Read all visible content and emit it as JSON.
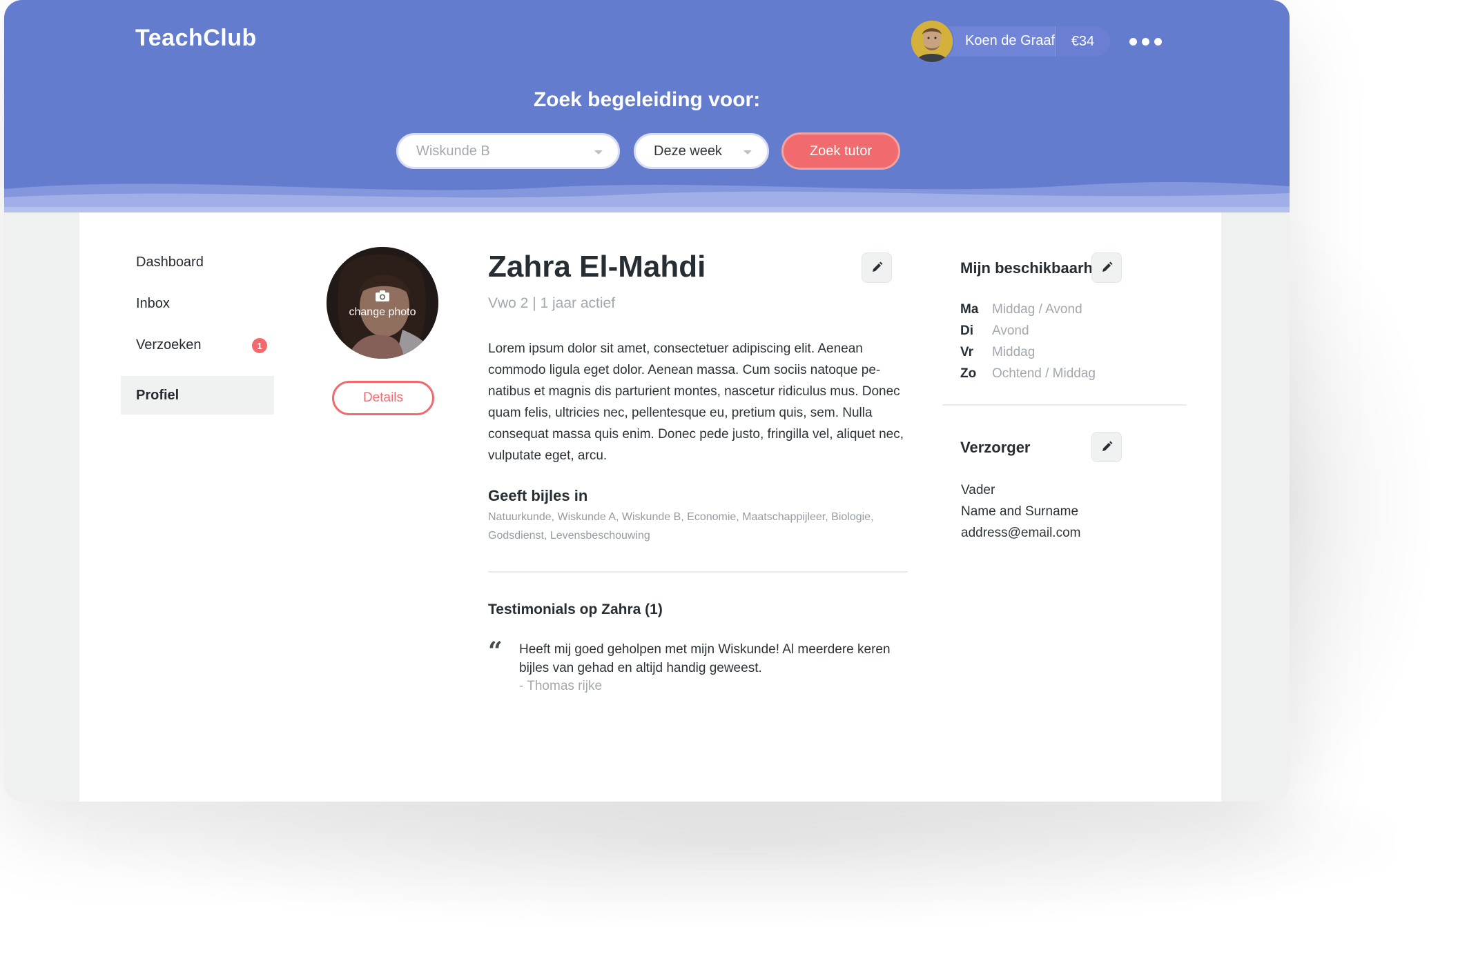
{
  "header": {
    "logo": "TeachClub",
    "user": {
      "name": "Koen de Graaf",
      "balance": "€34"
    },
    "search_title": "Zoek begeleiding voor:",
    "subject_select": {
      "value": "Wiskunde B"
    },
    "week_select": {
      "value": "Deze week"
    },
    "search_button": "Zoek tutor"
  },
  "sidebar": {
    "items": [
      {
        "label": "Dashboard"
      },
      {
        "label": "Inbox"
      },
      {
        "label": "Verzoeken",
        "badge": "1"
      },
      {
        "label": "Profiel",
        "active": true
      }
    ]
  },
  "profile": {
    "change_photo": "change photo",
    "details_button": "Details",
    "name": "Zahra El-Mahdi",
    "meta": "Vwo 2 | 1 jaar actief",
    "bio": "Lorem ipsum dolor sit amet, consectetuer adipiscing elit. Aenean commodo ligula eget dolor. Aenean massa. Cum sociis natoque pe-natibus et magnis dis parturient montes, nascetur ridiculus mus. Donec quam felis, ultricies nec, pellentesque eu, pretium quis, sem. Nulla consequat massa quis enim. Donec pede justo, fringilla vel, aliquet nec, vulputate eget, arcu.",
    "subjects_title": "Geeft bijles in",
    "subjects": "Natuurkunde, Wiskunde A, Wiskunde B, Economie, Maatschappijleer, Biologie, Godsdienst, Levensbeschouwing",
    "testimonials_title": "Testimonials op Zahra (1)",
    "testimonial": {
      "quote_mark": "“",
      "text": "Heeft mij goed geholpen met mijn Wiskunde! Al meerdere keren bijles van gehad en altijd handig geweest.",
      "author": "- Thomas rijke"
    }
  },
  "availability": {
    "title": "Mijn beschikbaarheid",
    "rows": [
      {
        "day": "Ma",
        "slot": "Middag / Avond"
      },
      {
        "day": "Di",
        "slot": "Avond"
      },
      {
        "day": "Vr",
        "slot": "Middag"
      },
      {
        "day": "Zo",
        "slot": "Ochtend / Middag"
      }
    ]
  },
  "guardian": {
    "title": "Verzorger",
    "relation": "Vader",
    "name": "Name and Surname",
    "email": "address@email.com"
  },
  "colors": {
    "header_bg": "#647cce",
    "accent": "#f16a6d",
    "page_bg": "#eef1f0"
  },
  "icons": {
    "more": "more-dots-icon",
    "edit": "pencil-icon",
    "camera": "camera-icon",
    "quote": "quote-icon",
    "caret": "chevron-down-icon"
  }
}
